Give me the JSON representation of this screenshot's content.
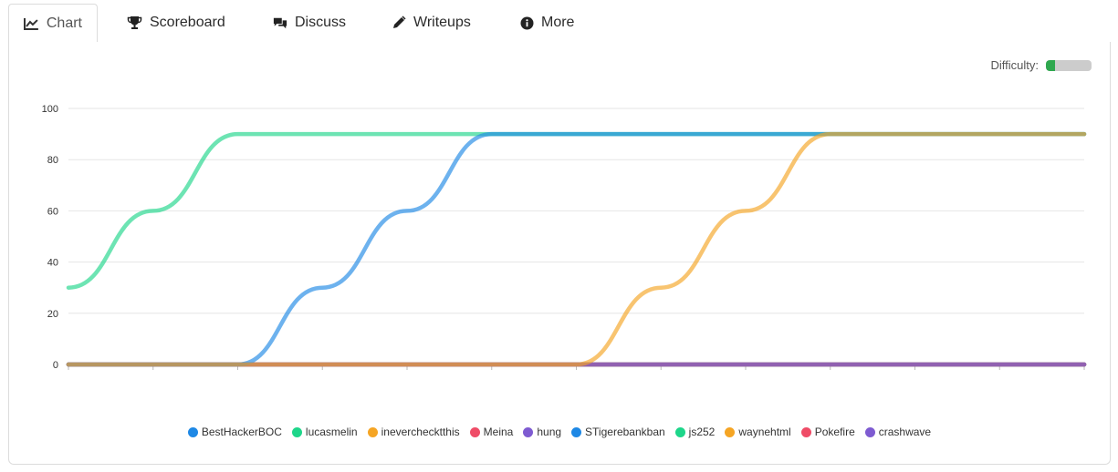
{
  "tabs": [
    {
      "label": "Chart",
      "icon": "line-chart-icon",
      "active": true
    },
    {
      "label": "Scoreboard",
      "icon": "trophy-icon"
    },
    {
      "label": "Discuss",
      "icon": "comments-icon"
    },
    {
      "label": "Writeups",
      "icon": "pencil-icon"
    },
    {
      "label": "More",
      "icon": "info-circle-icon"
    }
  ],
  "difficulty": {
    "label": "Difficulty:",
    "level": 0.2,
    "color": "#2fa84f"
  },
  "chart_data": {
    "type": "line",
    "ylim": [
      0,
      100
    ],
    "yticks": [
      0,
      20,
      40,
      60,
      80,
      100
    ],
    "grid": true,
    "legend_position": "bottom",
    "series": [
      {
        "name": "BestHackerBOC",
        "color": "#1e88e5",
        "values": [
          0,
          0,
          0,
          0,
          0,
          0,
          0,
          0,
          0,
          0,
          0,
          0,
          0
        ]
      },
      {
        "name": "lucasmelin",
        "color": "#1ed68a",
        "values": [
          30,
          60,
          90,
          90,
          90,
          90,
          90,
          90,
          90,
          90,
          90,
          90,
          90
        ]
      },
      {
        "name": "ineverchecktthis",
        "color": "#f5a524",
        "values": [
          0,
          0,
          0,
          0,
          0,
          0,
          0,
          0,
          0,
          0,
          0,
          0,
          0
        ]
      },
      {
        "name": "Meina",
        "color": "#ef4c67",
        "values": [
          0,
          0,
          0,
          0,
          0,
          0,
          0,
          0,
          0,
          0,
          0,
          0,
          0
        ]
      },
      {
        "name": "hung",
        "color": "#7e5bd1",
        "values": [
          0,
          0,
          0,
          0,
          0,
          0,
          0,
          0,
          0,
          0,
          0,
          0,
          0
        ]
      },
      {
        "name": "STigerebankban",
        "color": "#1e88e5",
        "values": [
          0,
          0,
          0,
          30,
          60,
          90,
          90,
          90,
          90,
          90,
          90,
          90,
          90
        ]
      },
      {
        "name": "js252",
        "color": "#1ed68a",
        "values": [
          0,
          0,
          0,
          0,
          0,
          0,
          0,
          0,
          0,
          0,
          0,
          0,
          0
        ]
      },
      {
        "name": "waynehtml",
        "color": "#f5a524",
        "values": [
          0,
          0,
          0,
          0,
          0,
          0,
          0,
          30,
          60,
          90,
          90,
          90,
          90
        ]
      },
      {
        "name": "Pokefire",
        "color": "#ef4c67",
        "values": [
          0,
          0,
          0,
          0,
          0,
          0,
          0,
          0,
          0,
          0,
          0,
          0,
          0
        ]
      },
      {
        "name": "crashwave",
        "color": "#7e5bd1",
        "values": [
          0,
          0,
          0,
          0,
          0,
          0,
          0,
          0,
          0,
          0,
          0,
          0,
          0
        ]
      }
    ]
  }
}
